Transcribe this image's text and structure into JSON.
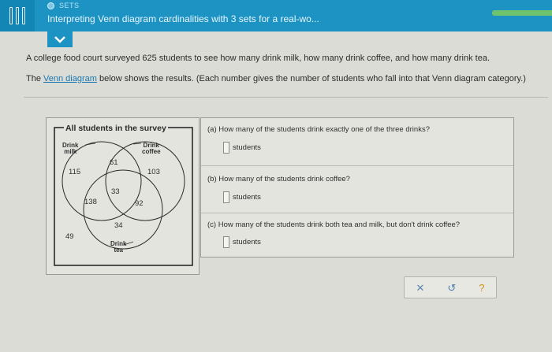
{
  "header": {
    "topic_label": "SETS",
    "title": "Interpreting Venn diagram cardinalities with 3 sets for a real-wo...",
    "accent_color": "#1d93c4",
    "progress_color": "#6fc36f"
  },
  "problem": {
    "line1": "A college food court surveyed 625 students to see how many drink milk, how many drink coffee, and how many drink tea.",
    "line2_prefix": "The ",
    "line2_link": "Venn diagram",
    "line2_suffix": " below shows the results. (Each number gives the number of students who fall into that Venn diagram category.)"
  },
  "venn": {
    "title": "All students in the survey",
    "set_milk_label_1": "Drink",
    "set_milk_label_2": "milk",
    "set_coffee_label_1": "Drink",
    "set_coffee_label_2": "coffee",
    "set_tea_label_1": "Drink",
    "set_tea_label_2": "tea",
    "milk_only": "115",
    "milk_coffee_only": "61",
    "coffee_only": "103",
    "all_three": "33",
    "milk_tea_only": "138",
    "coffee_tea_only": "92",
    "tea_only": "34",
    "outside": "49"
  },
  "questions": {
    "a_text": "(a) How many of the students drink exactly one of the three drinks?",
    "b_text": "(b) How many of the students drink coffee?",
    "c_text": "(c) How many of the students drink both tea and milk, but don't drink coffee?",
    "unit": "students"
  },
  "actions": {
    "clear": "✕",
    "undo": "↺",
    "help": "?"
  }
}
